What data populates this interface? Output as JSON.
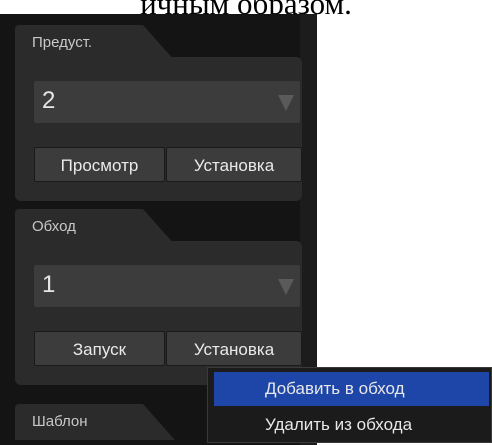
{
  "document": {
    "fragment": "ичным образом."
  },
  "presets": {
    "tab_label": "Предуст.",
    "selected_value": "2",
    "view_button": "Просмотр",
    "set_button": "Установка"
  },
  "tour": {
    "tab_label": "Обход",
    "selected_value": "1",
    "start_button": "Запуск",
    "set_button": "Установка"
  },
  "template": {
    "tab_label": "Шаблон"
  },
  "context_menu": {
    "items": [
      {
        "label": "Добавить в обход",
        "highlighted": true
      },
      {
        "label": "Удалить из обхода",
        "highlighted": false
      }
    ]
  },
  "colors": {
    "panel": "#2b2b2b",
    "background": "#141414",
    "highlight": "#1e46a8"
  }
}
